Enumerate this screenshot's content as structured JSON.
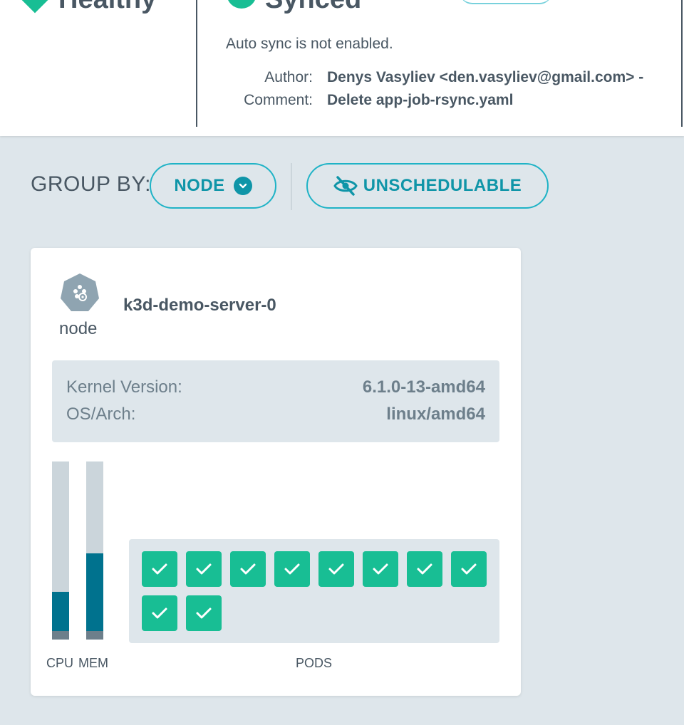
{
  "header": {
    "health_status": "Healthy",
    "sync_status": "Synced",
    "sync_note": "Auto sync is not enabled.",
    "author_label": "Author:",
    "author_value": "Denys Vasyliev <den.vasyliev@gmail.com> -",
    "comment_label": "Comment:",
    "comment_value": "Delete app-job-rsync.yaml"
  },
  "toolbar": {
    "group_by_label": "GROUP BY:",
    "group_by_value": "NODE",
    "unschedulable_label": "UNSCHEDULABLE"
  },
  "node_card": {
    "icon": "kubernetes-node-icon",
    "kind": "node",
    "name": "k3d-demo-server-0",
    "kernel_label": "Kernel Version:",
    "kernel_value": "6.1.0-13-amd64",
    "os_label": "OS/Arch:",
    "os_value": "linux/amd64",
    "cpu_label": "CPU",
    "mem_label": "MEM",
    "pods_label": "PODS",
    "cpu_usage_fraction": 0.23,
    "mem_usage_fraction": 0.46,
    "pods": [
      {
        "status": "healthy"
      },
      {
        "status": "healthy"
      },
      {
        "status": "healthy"
      },
      {
        "status": "healthy"
      },
      {
        "status": "healthy"
      },
      {
        "status": "healthy"
      },
      {
        "status": "healthy"
      },
      {
        "status": "healthy"
      },
      {
        "status": "healthy"
      },
      {
        "status": "healthy"
      }
    ]
  },
  "colors": {
    "accent": "#1fb3c6",
    "healthy": "#18be94",
    "usage": "#00728e",
    "text": "#495763"
  }
}
